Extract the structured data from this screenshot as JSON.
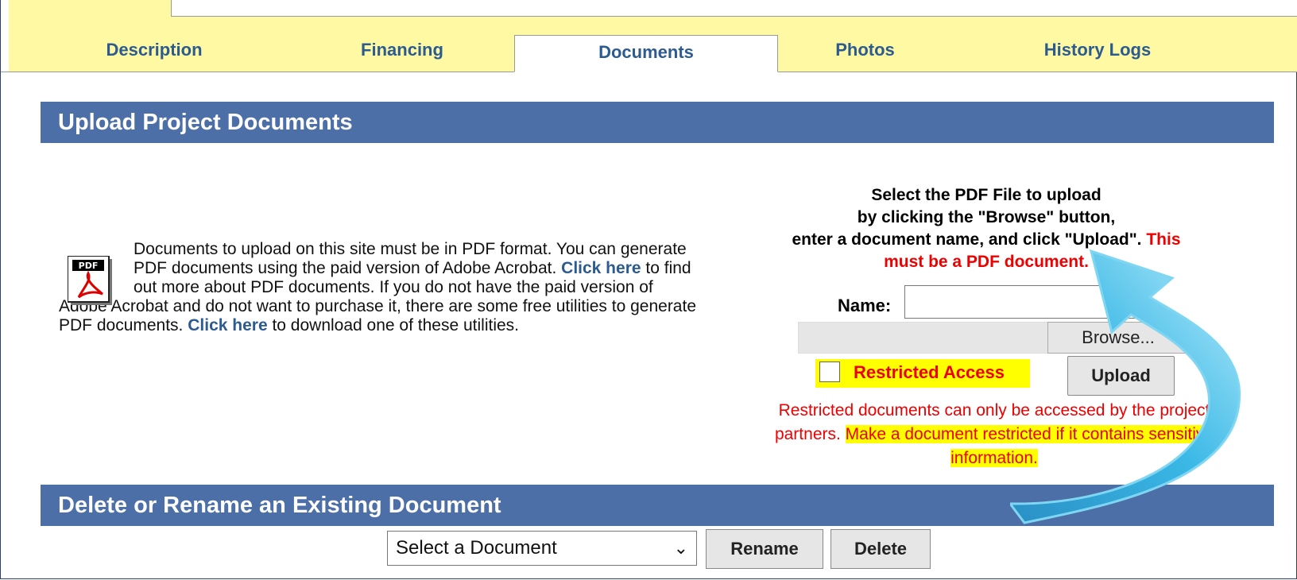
{
  "tabs": [
    {
      "label": "Description"
    },
    {
      "label": "Financing"
    },
    {
      "label": "Documents"
    },
    {
      "label": "Photos"
    },
    {
      "label": "History Logs"
    }
  ],
  "upload": {
    "header": "Upload Project Documents",
    "icon_text": "PDF",
    "intro": {
      "part1": "Documents to upload on this site must be in PDF format. You can generate PDF documents using the paid version of Adobe Acrobat. ",
      "link1": "Click here",
      "part2": " to find out more about PDF documents. If you do not have the paid version of Adobe Acrobat and do not want to purchase it, there are some free utilities to generate PDF documents. ",
      "link2": "Click here",
      "part3": " to download one of these utilities."
    },
    "instructions": {
      "line1": "Select the PDF File to upload",
      "line2": "by clicking the \"Browse\" button,",
      "line3": "enter a document name, and click \"Upload\".",
      "warning_a": "This",
      "warning_b": "must be a PDF document."
    },
    "name_label": "Name:",
    "name_value": "",
    "browse_label": "Browse...",
    "restricted_label": "Restricted Access",
    "upload_label": "Upload",
    "restricted_note": {
      "part1": "Restricted documents can only be accessed by the project partners. ",
      "highlight": "Make a document restricted if it contains sensitive information."
    }
  },
  "manage": {
    "header": "Delete or Rename an Existing Document",
    "select_value": "Select a Document",
    "rename_label": "Rename",
    "delete_label": "Delete"
  },
  "colors": {
    "tab_bar": "#fff9a3",
    "header_bg": "#4d6fa8",
    "link": "#2b5b8f",
    "warning": "#e00000",
    "highlight": "#ffff00",
    "arrow": "#3ab8e6"
  }
}
